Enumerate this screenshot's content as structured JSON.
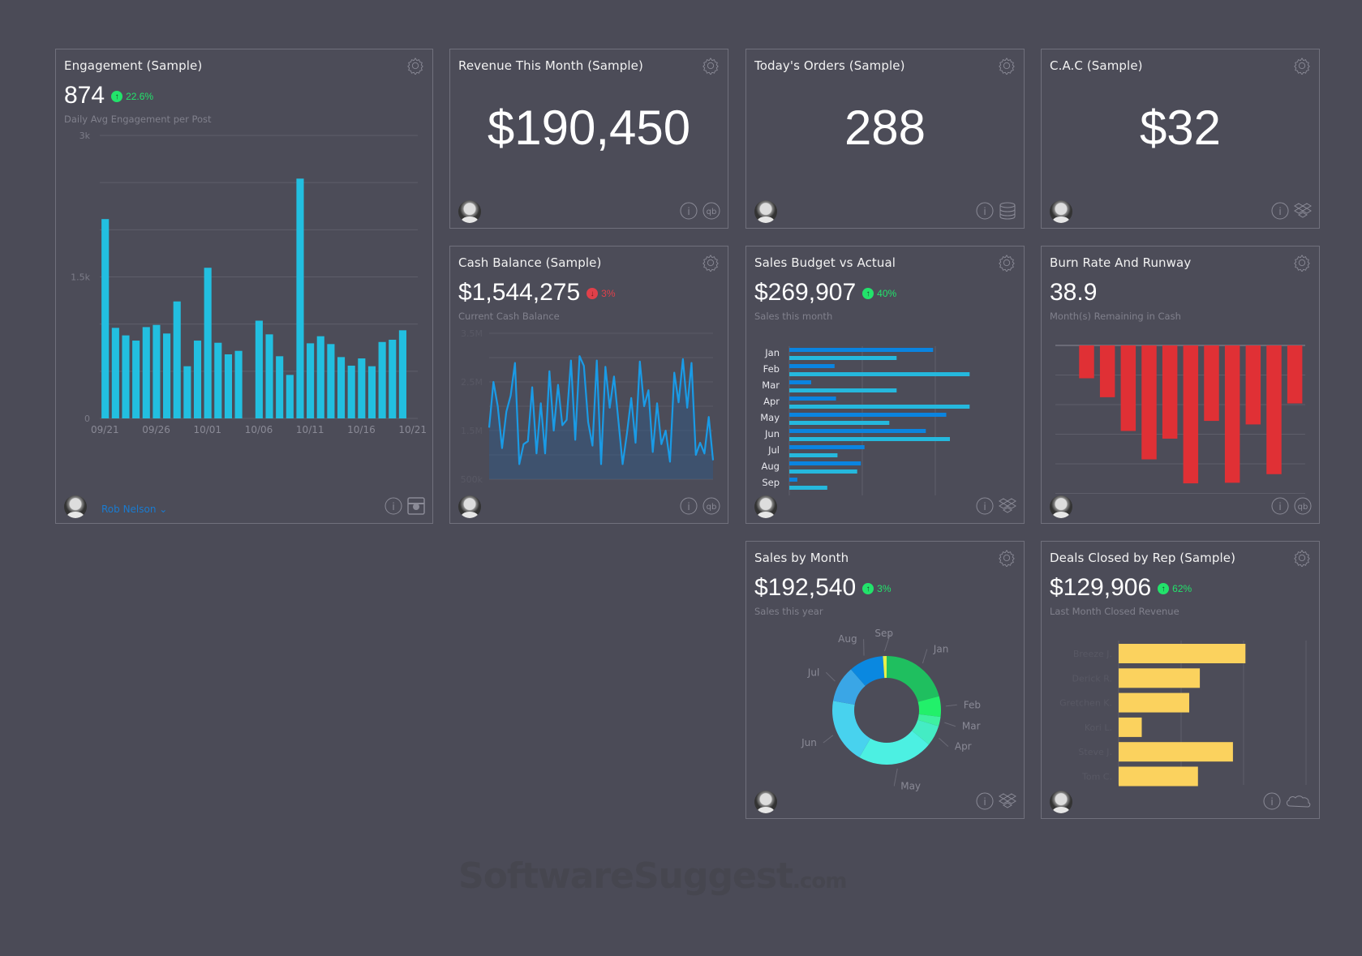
{
  "colors": {
    "background": "#4b4b57",
    "card_border": "#70707c",
    "up": "#22e36b",
    "down": "#e0404a",
    "engagement_bar": "#22bfe0",
    "cash_line": "#1a9be6",
    "budget": "#0a84e0",
    "actual": "#25b8dd",
    "burn": "#e03035",
    "deals": "#fbd25e"
  },
  "cards": {
    "engagement": {
      "title": "Engagement (Sample)",
      "value": "874",
      "delta": "22.6%",
      "delta_dir": "up",
      "subtitle": "Daily Avg Engagement per Post",
      "user": "Rob Nelson",
      "source_icon": "instagram-icon"
    },
    "revenue": {
      "title": "Revenue This Month (Sample)",
      "value": "$190,450",
      "source_icon": "quickbooks-icon"
    },
    "orders": {
      "title": "Today's Orders (Sample)",
      "value": "288",
      "source_icon": "database-icon"
    },
    "cac": {
      "title": "C.A.C (Sample)",
      "value": "$32",
      "source_icon": "dropbox-icon"
    },
    "cash": {
      "title": "Cash Balance (Sample)",
      "value": "$1,544,275",
      "delta": "3%",
      "delta_dir": "down",
      "subtitle": "Current Cash Balance",
      "source_icon": "quickbooks-icon"
    },
    "budget": {
      "title": "Sales Budget vs Actual",
      "value": "$269,907",
      "delta": "40%",
      "delta_dir": "up",
      "subtitle": "Sales this month",
      "source_icon": "dropbox-icon"
    },
    "burn": {
      "title": "Burn Rate And Runway",
      "value": "38.9",
      "subtitle": "Month(s) Remaining in Cash",
      "source_icon": "quickbooks-icon"
    },
    "salesmonth": {
      "title": "Sales by Month",
      "value": "$192,540",
      "delta": "3%",
      "delta_dir": "up",
      "subtitle": "Sales this year",
      "source_icon": "dropbox-icon"
    },
    "deals": {
      "title": "Deals Closed by Rep (Sample)",
      "value": "$129,906",
      "delta": "62%",
      "delta_dir": "up",
      "subtitle": "Last Month Closed Revenue",
      "source_icon": "salesforce-icon"
    }
  },
  "chart_data": [
    {
      "type": "bar",
      "id": "engagement",
      "x_ticks": [
        "09/21",
        "09/26",
        "10/01",
        "10/06",
        "10/11",
        "10/16",
        "10/21"
      ],
      "y_ticks": [
        "0",
        "1.5k",
        "3k"
      ],
      "ylim": [
        0,
        3000
      ],
      "grid": true,
      "x": [
        "09/21",
        "09/22",
        "09/23",
        "09/24",
        "09/25",
        "09/26",
        "09/27",
        "09/28",
        "09/29",
        "09/30",
        "10/01",
        "10/02",
        "10/03",
        "10/04",
        "10/05",
        "10/06",
        "10/07",
        "10/08",
        "10/09",
        "10/10",
        "10/11",
        "10/12",
        "10/13",
        "10/14",
        "10/15",
        "10/16",
        "10/17",
        "10/18",
        "10/19",
        "10/20"
      ],
      "values": [
        2113,
        960,
        880,
        825,
        968,
        991,
        900,
        1240,
        553,
        825,
        1597,
        802,
        679,
        716,
        0,
        1036,
        891,
        659,
        461,
        2542,
        796,
        871,
        788,
        650,
        559,
        636,
        553,
        810,
        834,
        934
      ]
    },
    {
      "type": "area",
      "id": "cash",
      "y_ticks": [
        "3.5M",
        "2.5M",
        "1.5M",
        "500k"
      ],
      "ylim": [
        0.5,
        3.5
      ],
      "unit": "M",
      "grid": true,
      "values": [
        1.56,
        2.5,
        2.0,
        1.14,
        1.89,
        2.22,
        2.89,
        0.81,
        1.22,
        1.28,
        2.39,
        1.03,
        2.06,
        1.03,
        2.72,
        1.5,
        2.44,
        1.61,
        1.72,
        2.94,
        1.31,
        3.03,
        2.83,
        1.67,
        1.19,
        2.94,
        0.81,
        2.81,
        1.97,
        2.61,
        1.72,
        0.81,
        1.44,
        2.17,
        1.25,
        2.92,
        2.0,
        2.33,
        1.06,
        2.06,
        1.22,
        1.5,
        0.86,
        2.69,
        2.08,
        2.97,
        1.97,
        2.89,
        1.0,
        1.25,
        1.03,
        1.78,
        0.89
      ]
    },
    {
      "type": "bar",
      "id": "budget",
      "orientation": "horizontal",
      "categories": [
        "Jan",
        "Feb",
        "Mar",
        "Apr",
        "May",
        "Jun",
        "Jul",
        "Aug",
        "Sep"
      ],
      "xlim": [
        0,
        300
      ],
      "grid": true,
      "series": [
        {
          "values": [
            197,
            62,
            30,
            64,
            215,
            187,
            103,
            98,
            11
          ]
        },
        {
          "values": [
            147,
            247,
            147,
            247,
            137,
            220,
            66,
            93,
            52
          ]
        }
      ]
    },
    {
      "type": "bar",
      "id": "burn",
      "ylim": [
        -5,
        0
      ],
      "grid": true,
      "values": [
        null,
        -1.11,
        -1.75,
        -2.89,
        -3.85,
        -3.15,
        -4.66,
        -2.55,
        -4.64,
        -2.67,
        -4.35,
        -1.96
      ]
    },
    {
      "type": "pie",
      "id": "salesmonth",
      "donut": true,
      "categories": [
        "Jan",
        "Feb",
        "Mar",
        "Apr",
        "May",
        "Jun",
        "Jul",
        "Aug",
        "Sep"
      ],
      "values": [
        20.8,
        6.1,
        2.8,
        6.1,
        22.5,
        19.4,
        10.8,
        10.3,
        1.1
      ],
      "colors": [
        "#1fbf5f",
        "#22f06a",
        "#3ef0a0",
        "#44ecc4",
        "#4cf0e2",
        "#48d2ee",
        "#3aa6e6",
        "#0a88e0",
        "#e6f04a"
      ]
    },
    {
      "type": "bar",
      "id": "deals",
      "orientation": "horizontal",
      "categories": [
        "Breeze J.",
        "Derick R.",
        "Gretchen K.",
        "Kori L.",
        "Steve J.",
        "Tom C."
      ],
      "xlim": [
        0,
        3
      ],
      "grid": true,
      "values": [
        2.03,
        1.3,
        1.13,
        0.37,
        1.83,
        1.27
      ]
    }
  ],
  "watermark": {
    "text": "SoftwareSuggest",
    ".com": ".com"
  }
}
